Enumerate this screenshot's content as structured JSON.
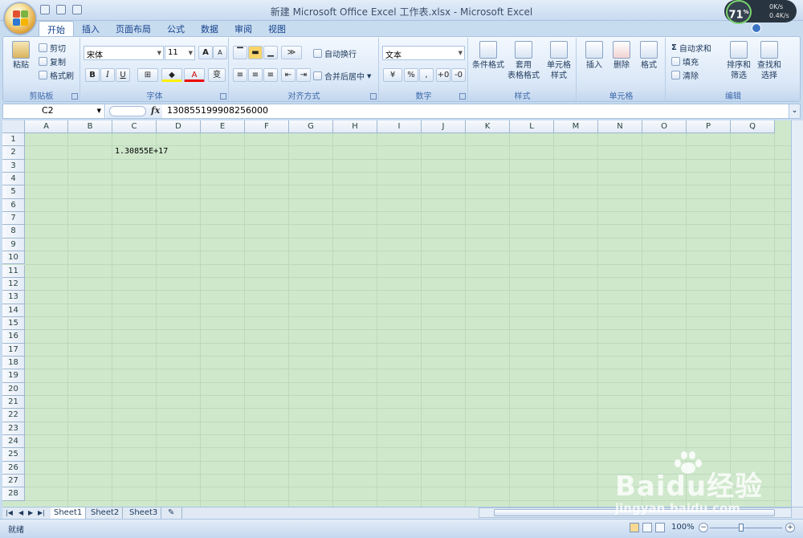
{
  "window": {
    "title": "新建 Microsoft Office Excel 工作表.xlsx - Microsoft Excel"
  },
  "speed": {
    "percent": "71",
    "unit": "%",
    "up": "0K/s",
    "down": "0.4K/s"
  },
  "tabs": [
    "开始",
    "插入",
    "页面布局",
    "公式",
    "数据",
    "审阅",
    "视图"
  ],
  "ribbon": {
    "clipboard": {
      "paste": "粘贴",
      "cut": "剪切",
      "copy": "复制",
      "format_painter": "格式刷",
      "label": "剪贴板"
    },
    "font": {
      "name": "宋体",
      "size": "11",
      "grow": "A",
      "shrink": "A",
      "bold": "B",
      "italic": "I",
      "underline": "U",
      "label": "字体",
      "phonetic": "变"
    },
    "alignment": {
      "wrap": "自动换行",
      "merge": "合并后居中",
      "label": "对齐方式"
    },
    "number": {
      "format": "文本",
      "percent": "%",
      "comma": ",",
      "label": "数字"
    },
    "styles": {
      "conditional": "条件格式",
      "table_a": "套用",
      "table_b": "表格格式",
      "cell_a": "单元格",
      "cell_b": "样式",
      "label": "样式"
    },
    "cells": {
      "insert": "插入",
      "delete": "删除",
      "format": "格式",
      "label": "单元格"
    },
    "editing": {
      "autosum": "自动求和",
      "fill": "填充",
      "clear": "清除",
      "sort_a": "排序和",
      "sort_b": "筛选",
      "find_a": "查找和",
      "find_b": "选择",
      "label": "编辑"
    }
  },
  "formula_bar": {
    "name_box": "C2",
    "fx": "fx",
    "content": "130855199908256000"
  },
  "grid": {
    "columns": [
      "A",
      "B",
      "C",
      "D",
      "E",
      "F",
      "G",
      "H",
      "I",
      "J",
      "K",
      "L",
      "M",
      "N",
      "O",
      "P",
      "Q"
    ],
    "rows": [
      "1",
      "2",
      "3",
      "4",
      "5",
      "6",
      "7",
      "8",
      "9",
      "10",
      "11",
      "12",
      "13",
      "14",
      "15",
      "16",
      "17",
      "18",
      "19",
      "20",
      "21",
      "22",
      "23",
      "24",
      "25",
      "26",
      "27",
      "28"
    ],
    "cell_c2": "1.30855E+17"
  },
  "sheets": [
    "Sheet1",
    "Sheet2",
    "Sheet3"
  ],
  "status": {
    "ready": "就绪",
    "zoom": "100%"
  },
  "watermark": {
    "brand": "Baidu经验",
    "url": "jingyan.baidu.com"
  },
  "colors": {
    "grid_bg": "#cfe8cc",
    "ribbon_bg": "#dbe8f7",
    "accent": "#15428b"
  }
}
